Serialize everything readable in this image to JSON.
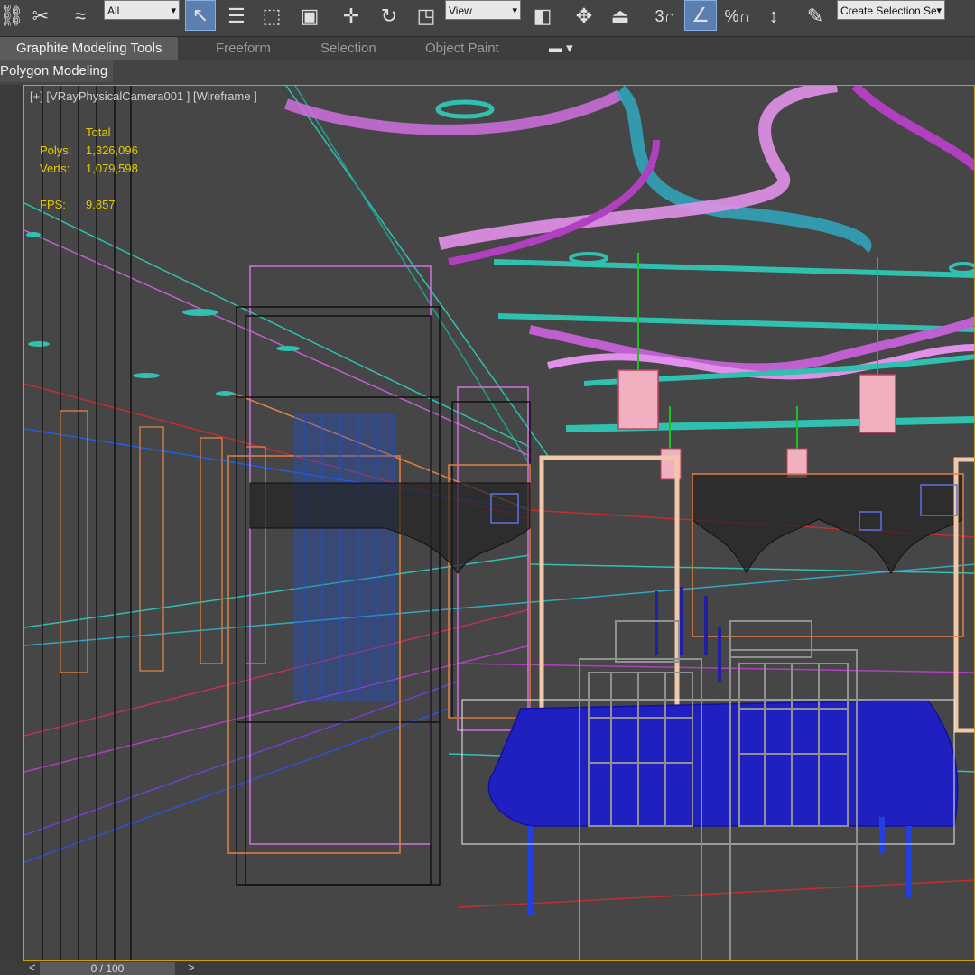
{
  "toolbar": {
    "filter_select": "All",
    "refcoord_select": "View",
    "snap_label": "3",
    "percent_label": "%",
    "named_selection_placeholder": "Create Selection Se"
  },
  "ribbon": {
    "tabs": [
      {
        "label": "Graphite Modeling Tools",
        "active": true
      },
      {
        "label": "Freeform",
        "active": false
      },
      {
        "label": "Selection",
        "active": false
      },
      {
        "label": "Object Paint",
        "active": false
      }
    ],
    "panel_label": "Polygon Modeling"
  },
  "viewport": {
    "label": "[+] [VRayPhysicalCamera001 ] [Wireframe ]",
    "stats_header": "Total",
    "polys_label": "Polys:",
    "polys_value": "1,326,096",
    "verts_label": "Verts:",
    "verts_value": "1,079,598",
    "fps_label": "FPS:",
    "fps_value": "9.857"
  },
  "timeline": {
    "frame": "0 / 100",
    "prev": "<",
    "next": ">"
  },
  "colors": {
    "viewport_border": "#c8a000",
    "stats_text": "#e8c800",
    "ceiling_magenta": "#d070e0",
    "ceiling_teal": "#30c0b0",
    "table_blue": "#2020c0",
    "chair_gray": "#909090",
    "cabinet_orange": "#e08040"
  }
}
